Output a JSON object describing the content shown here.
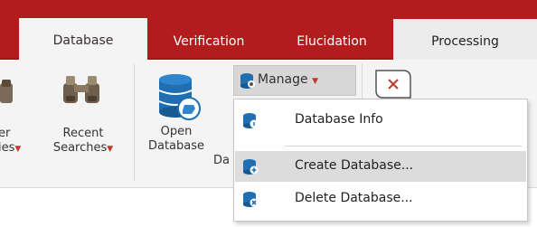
{
  "tabs": [
    {
      "label": "Database",
      "state": "active"
    },
    {
      "label": "Verification",
      "state": "normal"
    },
    {
      "label": "Elucidation",
      "state": "normal"
    },
    {
      "label": "Processing",
      "state": "normal"
    }
  ],
  "ribbon": {
    "partial_button": {
      "line1": "er",
      "line2": "ies"
    },
    "recent_searches": {
      "line1": "Recent",
      "line2": "Searches"
    },
    "open_database": {
      "line1": "Open",
      "line2": "Database"
    },
    "group_label_partial": "Da",
    "manage_button": {
      "label": "Manage"
    }
  },
  "manage_menu": {
    "items": [
      {
        "label": "Database Info",
        "icon": "database-info-icon"
      },
      {
        "label": "Create Database...",
        "icon": "create-database-icon",
        "highlighted": true
      },
      {
        "label": "Delete Database...",
        "icon": "delete-database-icon"
      }
    ]
  },
  "colors": {
    "accent": "#b31c1c",
    "ribbon": "#f4f4f4",
    "highlight": "#dcdcdc",
    "caret": "#c0392b"
  }
}
